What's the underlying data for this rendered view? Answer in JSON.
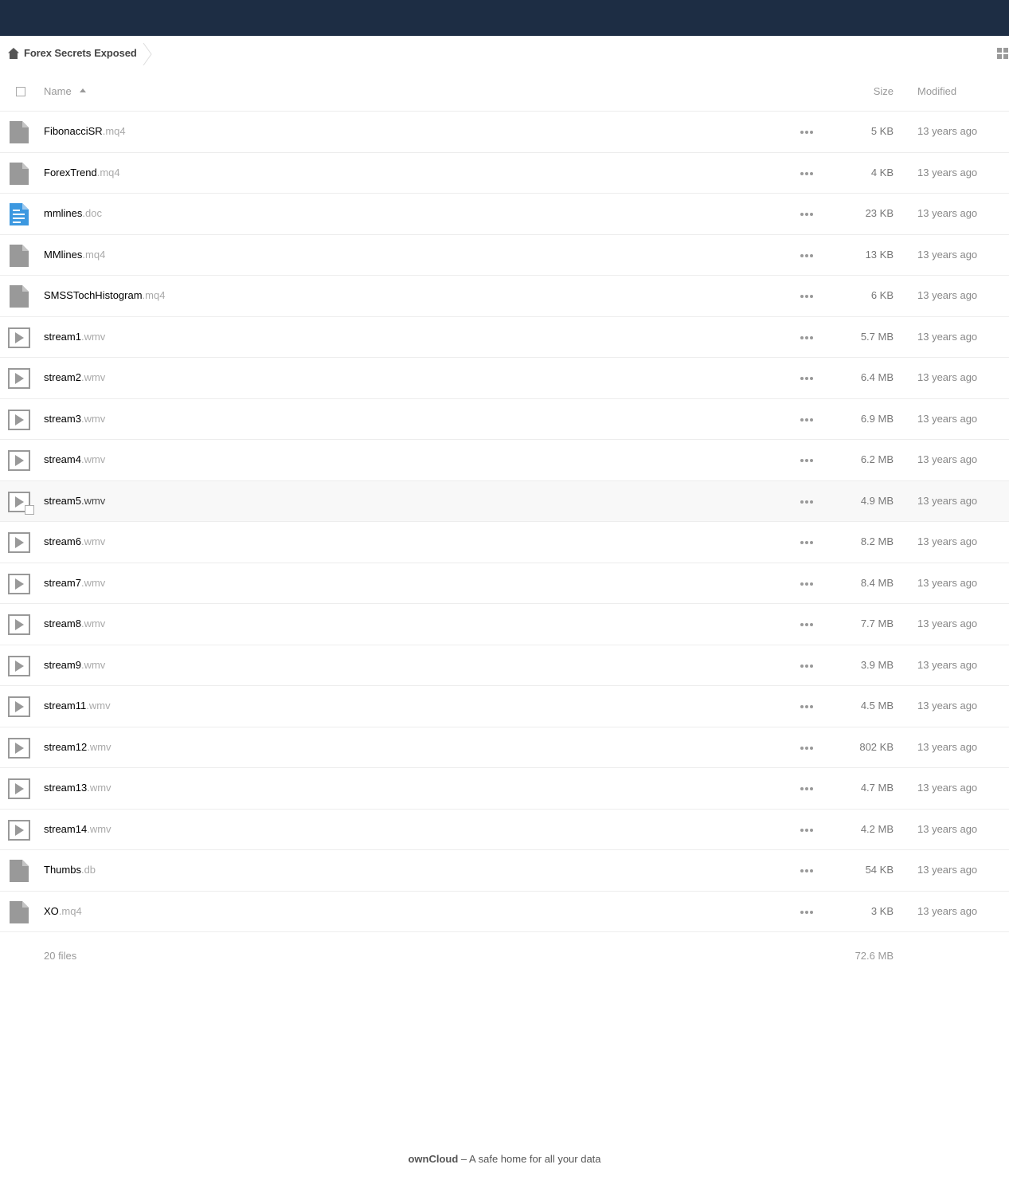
{
  "header": {
    "background": "#1d2d44"
  },
  "breadcrumb": {
    "home_icon": "home-icon",
    "current": "Forex Secrets Exposed"
  },
  "table": {
    "name_header": "Name",
    "size_header": "Size",
    "modified_header": "Modified",
    "sort": "name-ascending"
  },
  "files": [
    {
      "base": "FibonacciSR",
      "ext": ".mq4",
      "icon": "generic-file-icon",
      "size": "5 KB",
      "modified": "13 years ago"
    },
    {
      "base": "ForexTrend",
      "ext": ".mq4",
      "icon": "generic-file-icon",
      "size": "4 KB",
      "modified": "13 years ago"
    },
    {
      "base": "mmlines",
      "ext": ".doc",
      "icon": "document-file-icon",
      "size": "23 KB",
      "modified": "13 years ago"
    },
    {
      "base": "MMlines",
      "ext": ".mq4",
      "icon": "generic-file-icon",
      "size": "13 KB",
      "modified": "13 years ago"
    },
    {
      "base": "SMSSTochHistogram",
      "ext": ".mq4",
      "icon": "generic-file-icon",
      "size": "6 KB",
      "modified": "13 years ago"
    },
    {
      "base": "stream1",
      "ext": ".wmv",
      "icon": "video-file-icon",
      "size": "5.7 MB",
      "modified": "13 years ago"
    },
    {
      "base": "stream2",
      "ext": ".wmv",
      "icon": "video-file-icon",
      "size": "6.4 MB",
      "modified": "13 years ago"
    },
    {
      "base": "stream3",
      "ext": ".wmv",
      "icon": "video-file-icon",
      "size": "6.9 MB",
      "modified": "13 years ago"
    },
    {
      "base": "stream4",
      "ext": ".wmv",
      "icon": "video-file-icon",
      "size": "6.2 MB",
      "modified": "13 years ago"
    },
    {
      "base": "stream5",
      "ext": ".wmv",
      "icon": "video-file-icon",
      "size": "4.9 MB",
      "modified": "13 years ago",
      "hover": true
    },
    {
      "base": "stream6",
      "ext": ".wmv",
      "icon": "video-file-icon",
      "size": "8.2 MB",
      "modified": "13 years ago"
    },
    {
      "base": "stream7",
      "ext": ".wmv",
      "icon": "video-file-icon",
      "size": "8.4 MB",
      "modified": "13 years ago"
    },
    {
      "base": "stream8",
      "ext": ".wmv",
      "icon": "video-file-icon",
      "size": "7.7 MB",
      "modified": "13 years ago"
    },
    {
      "base": "stream9",
      "ext": ".wmv",
      "icon": "video-file-icon",
      "size": "3.9 MB",
      "modified": "13 years ago"
    },
    {
      "base": "stream11",
      "ext": ".wmv",
      "icon": "video-file-icon",
      "size": "4.5 MB",
      "modified": "13 years ago"
    },
    {
      "base": "stream12",
      "ext": ".wmv",
      "icon": "video-file-icon",
      "size": "802 KB",
      "modified": "13 years ago"
    },
    {
      "base": "stream13",
      "ext": ".wmv",
      "icon": "video-file-icon",
      "size": "4.7 MB",
      "modified": "13 years ago"
    },
    {
      "base": "stream14",
      "ext": ".wmv",
      "icon": "video-file-icon",
      "size": "4.2 MB",
      "modified": "13 years ago"
    },
    {
      "base": "Thumbs",
      "ext": ".db",
      "icon": "generic-file-icon",
      "size": "54 KB",
      "modified": "13 years ago"
    },
    {
      "base": "XO",
      "ext": ".mq4",
      "icon": "generic-file-icon",
      "size": "3 KB",
      "modified": "13 years ago"
    }
  ],
  "summary": {
    "count": "20 files",
    "total_size": "72.6 MB"
  },
  "footer": {
    "brand": "ownCloud",
    "tagline": " – A safe home for all your data"
  },
  "colors": {
    "doc_icon": "#3c98e0",
    "file_icon": "#999999",
    "row_hover": "#f8f8f8"
  }
}
